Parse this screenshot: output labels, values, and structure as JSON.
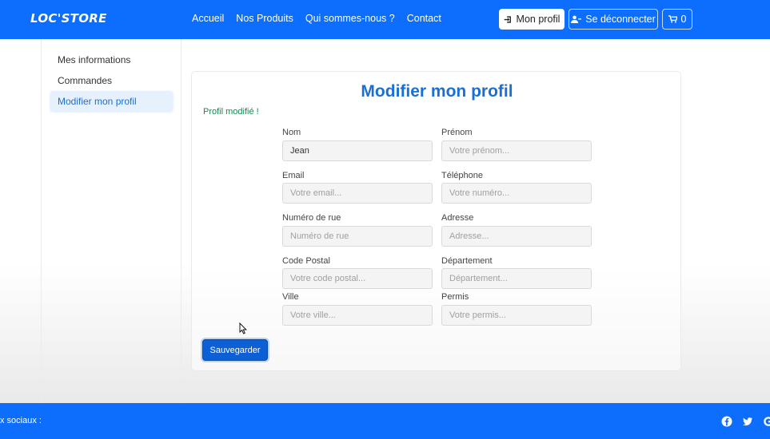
{
  "navbar": {
    "brand": "LOC'STORE",
    "links": [
      "Accueil",
      "Nos Produits",
      "Qui sommes-nous ?",
      "Contact"
    ],
    "profile_label": "Mon profil",
    "logout_label": "Se déconnecter",
    "cart_count": "0"
  },
  "sidebar": {
    "items": [
      {
        "label": "Mes informations"
      },
      {
        "label": "Commandes"
      },
      {
        "label": "Modifier mon profil",
        "active": true
      }
    ]
  },
  "form": {
    "title": "Modifier mon profil",
    "success": "Profil modifié !",
    "fields": [
      {
        "label": "Nom",
        "value": "Jean",
        "placeholder": ""
      },
      {
        "label": "Prénom",
        "value": "",
        "placeholder": "Votre prénom..."
      },
      {
        "label": "Email",
        "value": "",
        "placeholder": "Votre email..."
      },
      {
        "label": "Téléphone",
        "value": "",
        "placeholder": "Votre numéro..."
      },
      {
        "label": "Numéro de rue",
        "value": "",
        "placeholder": "Numéro de rue"
      },
      {
        "label": "Adresse",
        "value": "",
        "placeholder": "Adresse..."
      },
      {
        "label": "Code Postal",
        "value": "",
        "placeholder": "Votre code postal..."
      },
      {
        "label": "Département",
        "value": "",
        "placeholder": "Département..."
      },
      {
        "label": "Ville",
        "value": "",
        "placeholder": "Votre ville..."
      },
      {
        "label": "Permis",
        "value": "",
        "placeholder": "Votre permis..."
      }
    ],
    "save_label": "Sauvegarder"
  },
  "footer": {
    "text": "x sociaux :",
    "icons": [
      "facebook-icon",
      "twitter-icon",
      "google-icon"
    ]
  },
  "colors": {
    "primary": "#0d6efd",
    "title": "#1a6fd4",
    "success": "#198754"
  }
}
